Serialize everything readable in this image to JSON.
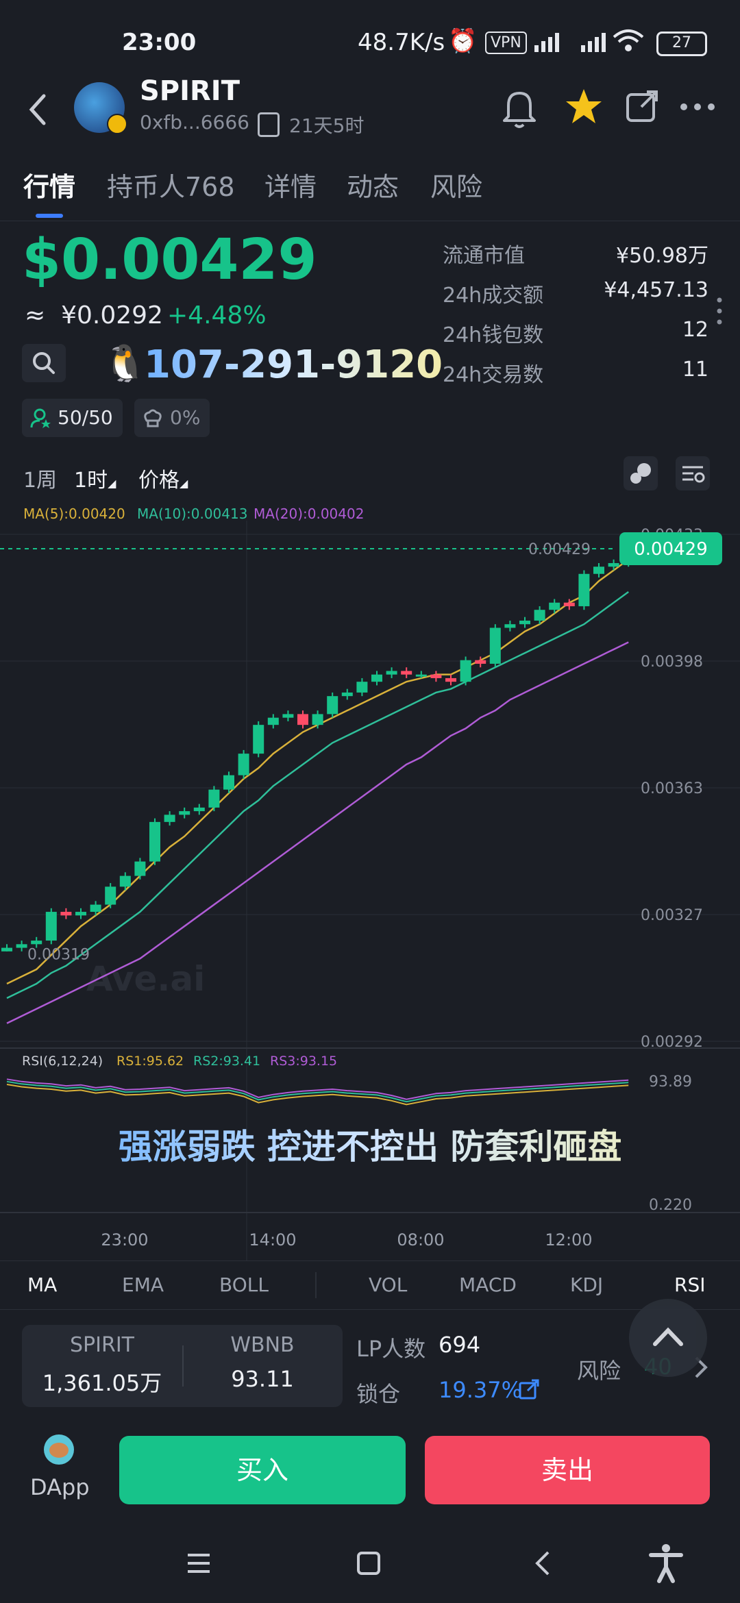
{
  "status_bar": {
    "time": "23:00",
    "speed": "48.7K/s",
    "vpn": "VPN",
    "battery": "27"
  },
  "header": {
    "token_name": "SPIRIT",
    "address": "0xfb...6666",
    "age": "21天5时",
    "icons": [
      "back-icon",
      "bell-icon",
      "star-icon",
      "share-icon",
      "more-icon"
    ]
  },
  "tabs": [
    {
      "label": "行情"
    },
    {
      "label": "持币人768"
    },
    {
      "label": "详情"
    },
    {
      "label": "动态"
    },
    {
      "label": "风险"
    }
  ],
  "price": {
    "usd": "$0.00429",
    "approx_symbol": "≈",
    "cny": "¥0.0292",
    "change": "+4.48%",
    "promo_number": "107-291-9120"
  },
  "badges": {
    "holders": "50/50",
    "tax": "0%"
  },
  "stats": [
    {
      "label": "流通市值",
      "value": "¥50.98万"
    },
    {
      "label": "24h成交额",
      "value": "¥4,457.13"
    },
    {
      "label": "24h钱包数",
      "value": "12"
    },
    {
      "label": "24h交易数",
      "value": "11"
    }
  ],
  "chart_toolbar": {
    "period": "1周",
    "interval": "1时",
    "mode": "价格"
  },
  "ma_legend": {
    "ma5": "MA(5):0.00420",
    "ma10": "MA(10):0.00413",
    "ma20": "MA(20):0.00402"
  },
  "rsi_legend": {
    "name": "RSI(6,12,24)",
    "rs1": "RS1:95.62",
    "rs2": "RS2:93.41",
    "rs3": "RS3:93.15",
    "top_label": "93.89",
    "bottom_label": "0.220"
  },
  "watermark": "Ave.ai",
  "slogan": "强涨弱跌 控进不控出 防套利砸盘",
  "colors": {
    "up": "#17c38a",
    "down": "#ff4d67",
    "ma5": "#d9b13a",
    "ma10": "#2fbf9a",
    "ma20": "#b05cd6",
    "rsi_line": "#b5b0c9"
  },
  "chart_data": {
    "type": "candlestick",
    "ylim": [
      0.00292,
      0.00433
    ],
    "y_ticks": [
      "0.00433",
      "0.00398",
      "0.00363",
      "0.00327",
      "0.00292"
    ],
    "x_ticks": [
      "23:00",
      "14:00",
      "08:00",
      "12:00"
    ],
    "last_price": "0.00429",
    "last_price_tag": "0.00429",
    "low_marker": "0.00319",
    "candles": [
      {
        "o": 0.00317,
        "c": 0.00318,
        "h": 0.00319,
        "l": 0.00317
      },
      {
        "o": 0.00318,
        "c": 0.00319,
        "h": 0.0032,
        "l": 0.00317
      },
      {
        "o": 0.00319,
        "c": 0.0032,
        "h": 0.00321,
        "l": 0.00318
      },
      {
        "o": 0.0032,
        "c": 0.00328,
        "h": 0.00329,
        "l": 0.00319
      },
      {
        "o": 0.00328,
        "c": 0.00327,
        "h": 0.00329,
        "l": 0.00326
      },
      {
        "o": 0.00327,
        "c": 0.00328,
        "h": 0.00329,
        "l": 0.00326
      },
      {
        "o": 0.00328,
        "c": 0.0033,
        "h": 0.00331,
        "l": 0.00327
      },
      {
        "o": 0.0033,
        "c": 0.00335,
        "h": 0.00336,
        "l": 0.00329
      },
      {
        "o": 0.00335,
        "c": 0.00338,
        "h": 0.00339,
        "l": 0.00334
      },
      {
        "o": 0.00338,
        "c": 0.00342,
        "h": 0.00343,
        "l": 0.00337
      },
      {
        "o": 0.00342,
        "c": 0.00353,
        "h": 0.00354,
        "l": 0.00341
      },
      {
        "o": 0.00353,
        "c": 0.00355,
        "h": 0.00356,
        "l": 0.00352
      },
      {
        "o": 0.00355,
        "c": 0.00356,
        "h": 0.00357,
        "l": 0.00354
      },
      {
        "o": 0.00356,
        "c": 0.00357,
        "h": 0.00358,
        "l": 0.00355
      },
      {
        "o": 0.00357,
        "c": 0.00362,
        "h": 0.00363,
        "l": 0.00356
      },
      {
        "o": 0.00362,
        "c": 0.00366,
        "h": 0.00367,
        "l": 0.00361
      },
      {
        "o": 0.00366,
        "c": 0.00372,
        "h": 0.00373,
        "l": 0.00365
      },
      {
        "o": 0.00372,
        "c": 0.0038,
        "h": 0.00381,
        "l": 0.00371
      },
      {
        "o": 0.0038,
        "c": 0.00382,
        "h": 0.00383,
        "l": 0.00379
      },
      {
        "o": 0.00382,
        "c": 0.00383,
        "h": 0.00384,
        "l": 0.00381
      },
      {
        "o": 0.00383,
        "c": 0.0038,
        "h": 0.00384,
        "l": 0.00379
      },
      {
        "o": 0.0038,
        "c": 0.00383,
        "h": 0.00384,
        "l": 0.00379
      },
      {
        "o": 0.00383,
        "c": 0.00388,
        "h": 0.00389,
        "l": 0.00382
      },
      {
        "o": 0.00388,
        "c": 0.00389,
        "h": 0.0039,
        "l": 0.00387
      },
      {
        "o": 0.00389,
        "c": 0.00392,
        "h": 0.00393,
        "l": 0.00388
      },
      {
        "o": 0.00392,
        "c": 0.00394,
        "h": 0.00395,
        "l": 0.00391
      },
      {
        "o": 0.00394,
        "c": 0.00395,
        "h": 0.00396,
        "l": 0.00393
      },
      {
        "o": 0.00395,
        "c": 0.00394,
        "h": 0.00396,
        "l": 0.00393
      },
      {
        "o": 0.00394,
        "c": 0.00394,
        "h": 0.00395,
        "l": 0.00393
      },
      {
        "o": 0.00394,
        "c": 0.00393,
        "h": 0.00395,
        "l": 0.00392
      },
      {
        "o": 0.00393,
        "c": 0.00392,
        "h": 0.00394,
        "l": 0.00391
      },
      {
        "o": 0.00392,
        "c": 0.00398,
        "h": 0.00399,
        "l": 0.00391
      },
      {
        "o": 0.00398,
        "c": 0.00397,
        "h": 0.00399,
        "l": 0.00396
      },
      {
        "o": 0.00397,
        "c": 0.00407,
        "h": 0.00408,
        "l": 0.00396
      },
      {
        "o": 0.00407,
        "c": 0.00408,
        "h": 0.00409,
        "l": 0.00406
      },
      {
        "o": 0.00408,
        "c": 0.00409,
        "h": 0.0041,
        "l": 0.00407
      },
      {
        "o": 0.00409,
        "c": 0.00412,
        "h": 0.00413,
        "l": 0.00408
      },
      {
        "o": 0.00412,
        "c": 0.00414,
        "h": 0.00415,
        "l": 0.00411
      },
      {
        "o": 0.00414,
        "c": 0.00413,
        "h": 0.00415,
        "l": 0.00412
      },
      {
        "o": 0.00413,
        "c": 0.00422,
        "h": 0.00423,
        "l": 0.00412
      },
      {
        "o": 0.00422,
        "c": 0.00424,
        "h": 0.00425,
        "l": 0.00421
      },
      {
        "o": 0.00424,
        "c": 0.00425,
        "h": 0.00426,
        "l": 0.00423
      },
      {
        "o": 0.00425,
        "c": 0.00429,
        "h": 0.00431,
        "l": 0.00424
      }
    ],
    "ma5": [
      0.00308,
      0.0031,
      0.00312,
      0.00316,
      0.0032,
      0.00324,
      0.00327,
      0.0033,
      0.00334,
      0.00338,
      0.00342,
      0.00346,
      0.00349,
      0.00353,
      0.00357,
      0.00361,
      0.00365,
      0.00368,
      0.00372,
      0.00375,
      0.00378,
      0.0038,
      0.00382,
      0.00384,
      0.00386,
      0.00388,
      0.0039,
      0.00392,
      0.00393,
      0.00394,
      0.00394,
      0.00396,
      0.00398,
      0.004,
      0.00403,
      0.00406,
      0.00408,
      0.00411,
      0.00414,
      0.00416,
      0.0042,
      0.00423,
      0.00426
    ],
    "ma10": [
      0.00304,
      0.00306,
      0.00308,
      0.00311,
      0.00313,
      0.00316,
      0.00319,
      0.00322,
      0.00325,
      0.00328,
      0.00332,
      0.00336,
      0.0034,
      0.00344,
      0.00348,
      0.00352,
      0.00356,
      0.00359,
      0.00363,
      0.00366,
      0.00369,
      0.00372,
      0.00375,
      0.00377,
      0.00379,
      0.00381,
      0.00383,
      0.00385,
      0.00387,
      0.00389,
      0.0039,
      0.00392,
      0.00394,
      0.00396,
      0.00398,
      0.004,
      0.00402,
      0.00404,
      0.00406,
      0.00408,
      0.00411,
      0.00414,
      0.00417
    ],
    "ma20": [
      0.00297,
      0.00299,
      0.00301,
      0.00303,
      0.00305,
      0.00307,
      0.00309,
      0.00311,
      0.00313,
      0.00315,
      0.00318,
      0.00321,
      0.00324,
      0.00327,
      0.0033,
      0.00333,
      0.00336,
      0.00339,
      0.00342,
      0.00345,
      0.00348,
      0.00351,
      0.00354,
      0.00357,
      0.0036,
      0.00363,
      0.00366,
      0.00369,
      0.00371,
      0.00374,
      0.00377,
      0.00379,
      0.00382,
      0.00384,
      0.00387,
      0.00389,
      0.00391,
      0.00393,
      0.00395,
      0.00397,
      0.00399,
      0.00401,
      0.00403
    ],
    "rsi": [
      94,
      93.5,
      93.2,
      93,
      92.6,
      92.8,
      92.2,
      92.5,
      91.8,
      91.9,
      92.1,
      92.3,
      91.6,
      91.8,
      92.0,
      92.2,
      91.5,
      90.2,
      90.8,
      91.2,
      91.5,
      91.7,
      91.9,
      91.6,
      91.4,
      91.2,
      90.6,
      89.8,
      90.4,
      91.0,
      91.2,
      91.6,
      91.8,
      92.0,
      92.2,
      92.4,
      92.6,
      92.8,
      93.0,
      93.2,
      93.4,
      93.6,
      93.8
    ]
  },
  "indicators": [
    "MA",
    "EMA",
    "BOLL",
    "VOL",
    "MACD",
    "KDJ",
    "RSI"
  ],
  "pool": {
    "token_a": "SPIRIT",
    "amount_a": "1,361.05万",
    "token_b": "WBNB",
    "amount_b": "93.11",
    "lp_label": "LP人数",
    "lp_value": "694",
    "lock_label": "锁仓",
    "lock_value": "19.37%",
    "risk_label": "风险",
    "risk_value": "40"
  },
  "actions": {
    "dapp": "DApp",
    "buy": "买入",
    "sell": "卖出"
  }
}
